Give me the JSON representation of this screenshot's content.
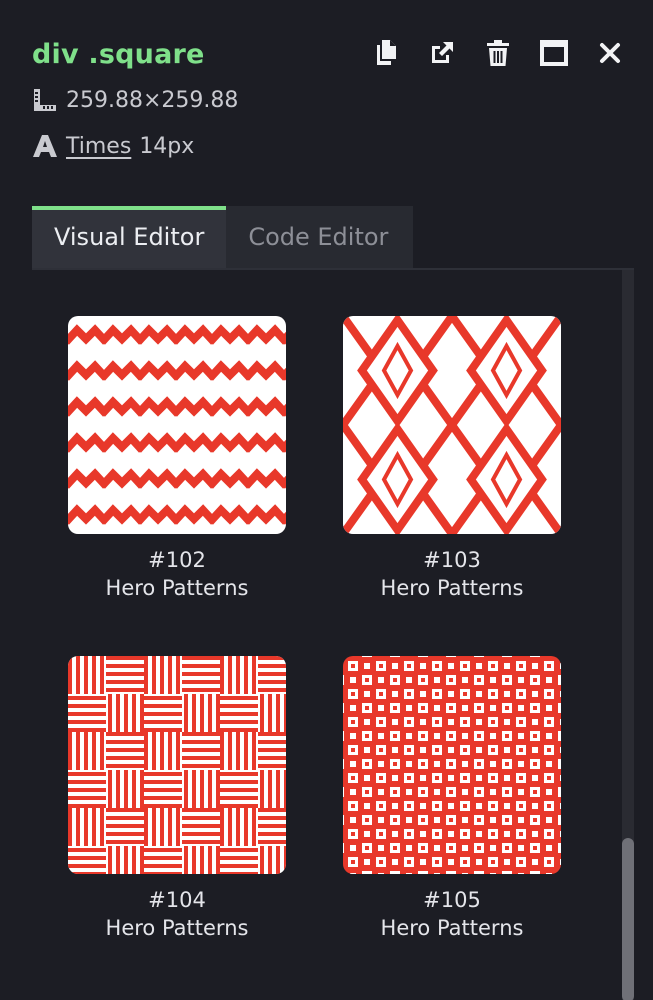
{
  "header": {
    "tag": "div",
    "class_name": ".square",
    "dimensions": "259.88×259.88",
    "font_family": "Times",
    "font_size": "14px"
  },
  "toolbar": {
    "icons": [
      "copy-icon",
      "open-external-icon",
      "trash-icon",
      "panel-icon",
      "close-icon"
    ]
  },
  "tabs": [
    {
      "label": "Visual Editor",
      "active": true
    },
    {
      "label": "Code Editor",
      "active": false
    }
  ],
  "patterns": [
    {
      "number": "#102",
      "source": "Hero Patterns"
    },
    {
      "number": "#103",
      "source": "Hero Patterns"
    },
    {
      "number": "#104",
      "source": "Hero Patterns"
    },
    {
      "number": "#105",
      "source": "Hero Patterns"
    }
  ],
  "colors": {
    "accent": "#7fe08a",
    "pattern_red": "#e8382a",
    "background": "#1c1d24"
  }
}
